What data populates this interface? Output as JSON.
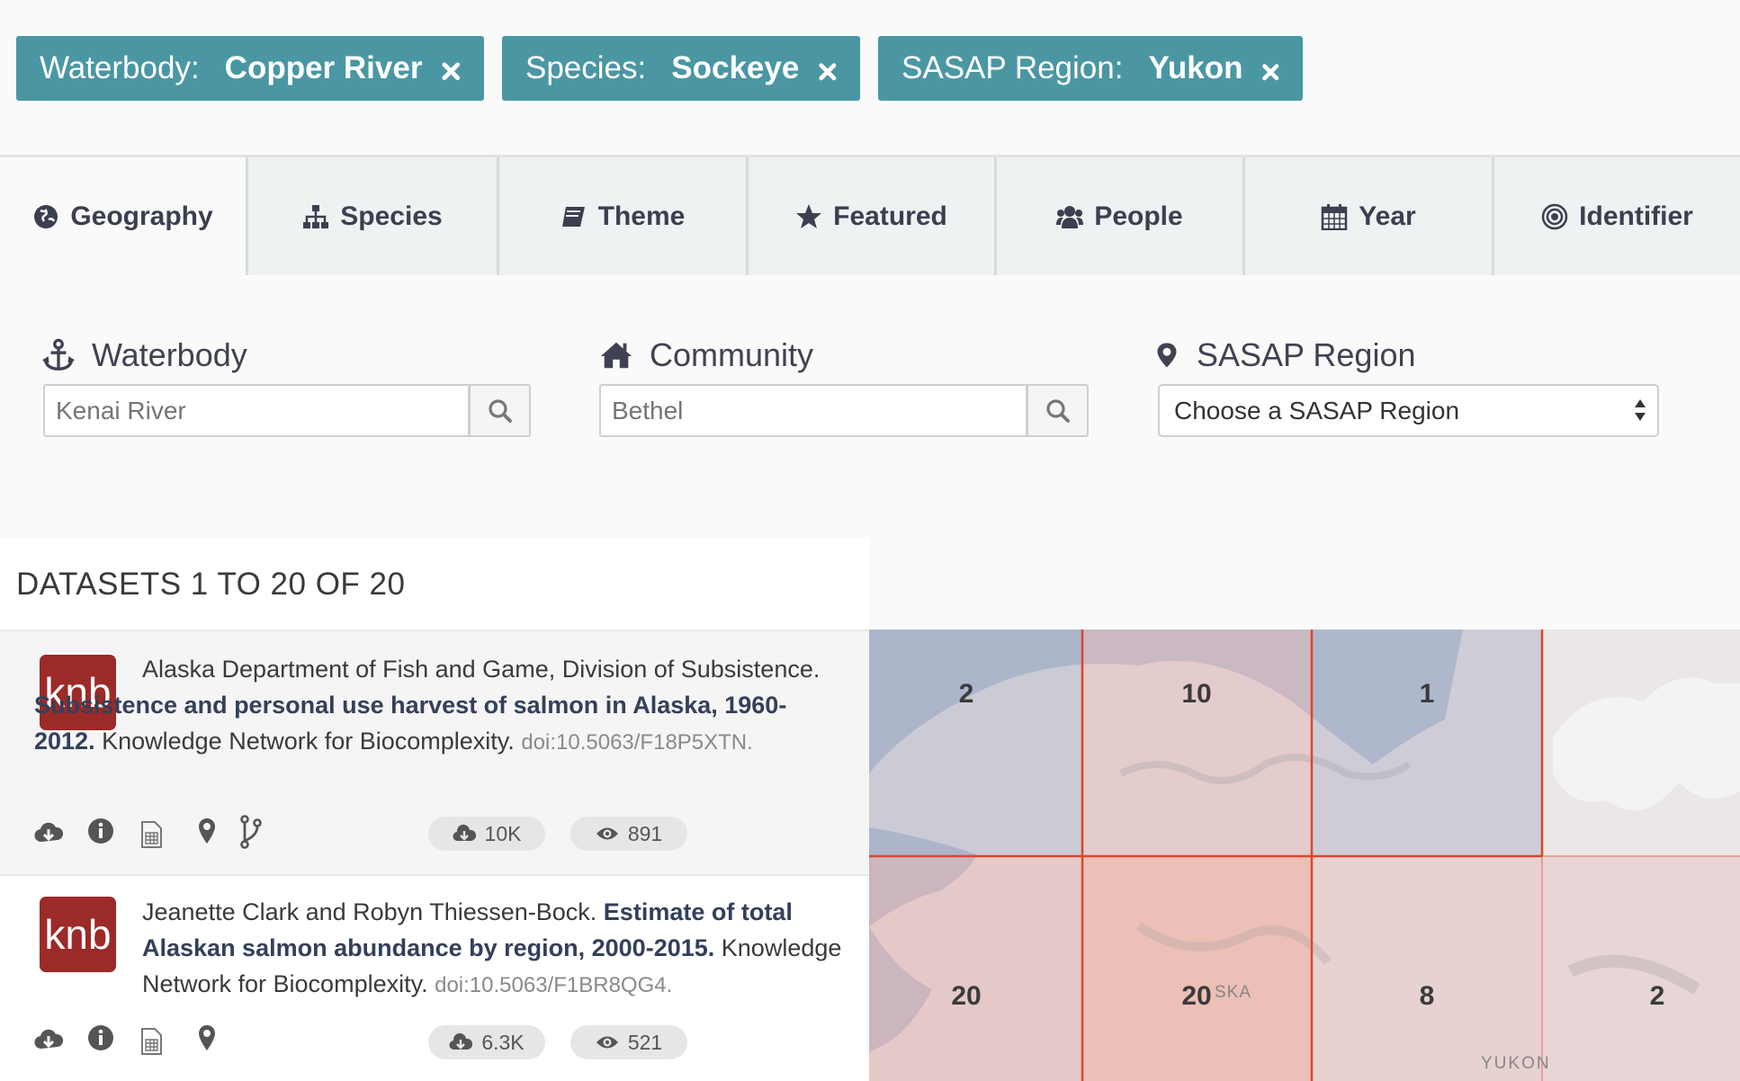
{
  "filters": [
    {
      "key": "Waterbody:",
      "value": "Copper River"
    },
    {
      "key": "Species:",
      "value": "Sockeye"
    },
    {
      "key": "SASAP Region:",
      "value": "Yukon"
    }
  ],
  "tabs": [
    {
      "label": "Geography",
      "icon": "globe-icon",
      "active": true
    },
    {
      "label": "Species",
      "icon": "sitemap-icon"
    },
    {
      "label": "Theme",
      "icon": "book-icon"
    },
    {
      "label": "Featured",
      "icon": "star-icon"
    },
    {
      "label": "People",
      "icon": "users-icon"
    },
    {
      "label": "Year",
      "icon": "calendar-icon"
    },
    {
      "label": "Identifier",
      "icon": "bullseye-icon"
    }
  ],
  "geography": {
    "waterbody": {
      "label": "Waterbody",
      "placeholder": "Kenai River",
      "icon": "anchor-icon"
    },
    "community": {
      "label": "Community",
      "placeholder": "Bethel",
      "icon": "home-icon"
    },
    "region": {
      "label": "SASAP Region",
      "selected": "Choose a SASAP Region",
      "icon": "map-marker-icon"
    }
  },
  "results": {
    "heading": "DATASETS 1 TO 20 OF 20",
    "items": [
      {
        "logo": "knb",
        "authors": "Alaska Department of Fish and Game, Division of Subsistence.",
        "title": "Subsistence and personal use harvest of salmon in Alaska, 1960-2012.",
        "publisher": "Knowledge Network for Biocomplexity.",
        "doi": "doi:10.5063/F18P5XTN.",
        "downloads": "10K",
        "views": "891"
      },
      {
        "logo": "knb",
        "authors": "Jeanette Clark and Robyn Thiessen-Bock.",
        "title": "Estimate of total Alaskan salmon abundance by region, 2000-2015.",
        "publisher": "Knowledge Network for Biocomplexity.",
        "doi": "doi:10.5063/F1BR8QG4.",
        "downloads": "6.3K",
        "views": "521"
      }
    ]
  },
  "map": {
    "counts": [
      "2",
      "10",
      "1",
      "20",
      "20",
      "8",
      "2"
    ],
    "labels": [
      "SKA",
      "YUKON"
    ],
    "grid_color": "#d9472e"
  }
}
